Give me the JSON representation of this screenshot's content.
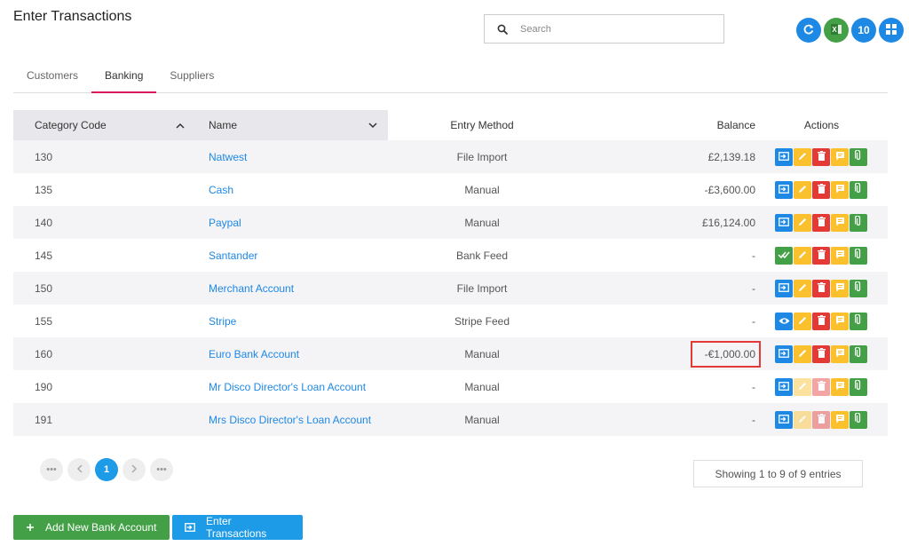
{
  "header": {
    "title": "Enter Transactions",
    "search_placeholder": "Search",
    "count_badge": "10"
  },
  "tabs": [
    {
      "label": "Customers",
      "active": false
    },
    {
      "label": "Banking",
      "active": true
    },
    {
      "label": "Suppliers",
      "active": false
    }
  ],
  "table": {
    "columns": {
      "code": "Category Code",
      "name": "Name",
      "entry": "Entry Method",
      "balance": "Balance",
      "actions": "Actions"
    },
    "rows": [
      {
        "code": "130",
        "name": "Natwest",
        "entry": "File Import",
        "balance": "£2,139.18",
        "first_action": "import",
        "faded": false
      },
      {
        "code": "135",
        "name": "Cash",
        "entry": "Manual",
        "balance": "-£3,600.00",
        "first_action": "import",
        "faded": false
      },
      {
        "code": "140",
        "name": "Paypal",
        "entry": "Manual",
        "balance": "£16,124.00",
        "first_action": "import",
        "faded": false
      },
      {
        "code": "145",
        "name": "Santander",
        "entry": "Bank Feed",
        "balance": "-",
        "first_action": "check",
        "faded": false
      },
      {
        "code": "150",
        "name": "Merchant Account",
        "entry": "File Import",
        "balance": "-",
        "first_action": "import",
        "faded": false
      },
      {
        "code": "155",
        "name": "Stripe",
        "entry": "Stripe Feed",
        "balance": "-",
        "first_action": "eye",
        "faded": false
      },
      {
        "code": "160",
        "name": "Euro Bank Account",
        "entry": "Manual",
        "balance": "-€1,000.00",
        "first_action": "import",
        "faded": false,
        "highlight": true
      },
      {
        "code": "190",
        "name": "Mr Disco Director's Loan Account",
        "entry": "Manual",
        "balance": "-",
        "first_action": "import",
        "faded": true
      },
      {
        "code": "191",
        "name": "Mrs Disco Director's Loan Account",
        "entry": "Manual",
        "balance": "-",
        "first_action": "import",
        "faded": true
      }
    ]
  },
  "pagination": {
    "current_page": "1",
    "info": "Showing 1 to 9 of 9 entries"
  },
  "footer": {
    "add_label": "Add New Bank Account",
    "enter_label": "Enter Transactions"
  },
  "colors": {
    "primary": "#1e88e5",
    "success": "#43a047",
    "warning": "#fbc02d",
    "danger": "#e53935",
    "tab_accent": "#d81b60"
  }
}
